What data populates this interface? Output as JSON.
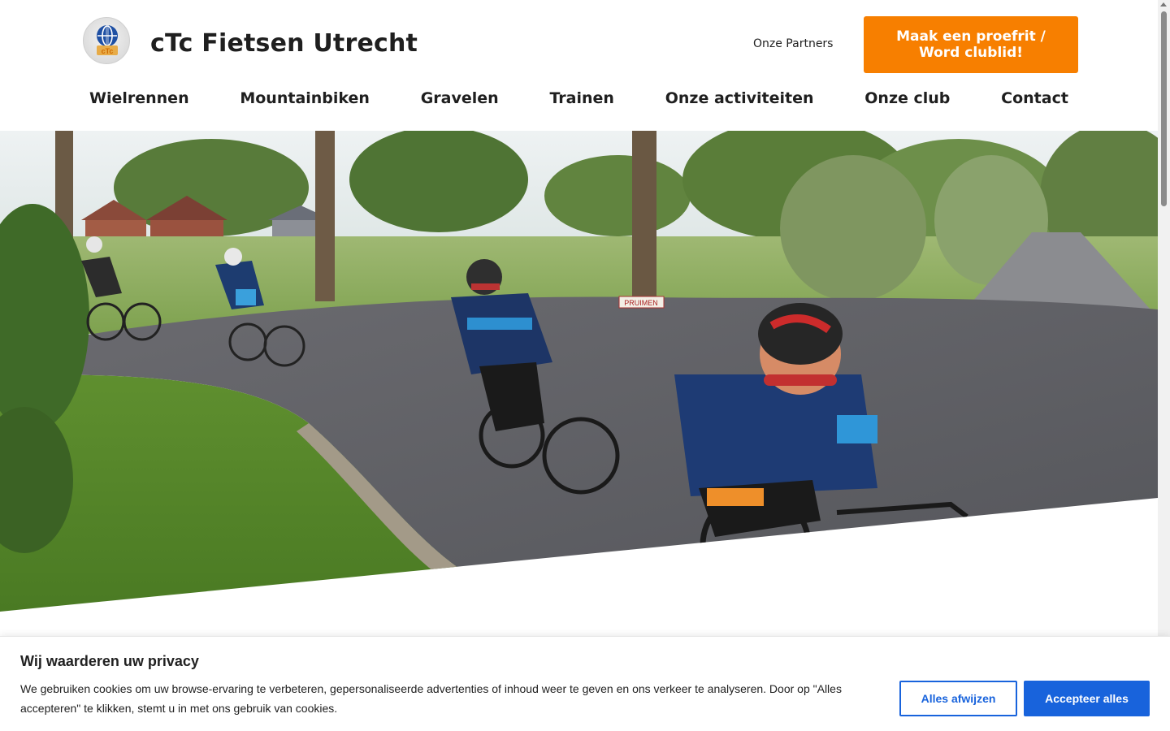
{
  "header": {
    "site_title": "cTc Fietsen Utrecht",
    "logo_text": "cTc",
    "partners_label": "Onze Partners",
    "cta_label": "Maak een proefrit / Word clublid!"
  },
  "nav": {
    "items": [
      {
        "label": "Wielrennen"
      },
      {
        "label": "Mountainbiken"
      },
      {
        "label": "Gravelen"
      },
      {
        "label": "Trainen"
      },
      {
        "label": "Onze activiteiten"
      },
      {
        "label": "Onze club"
      },
      {
        "label": "Contact"
      }
    ]
  },
  "hero": {
    "sign_text": "PRUIMEN"
  },
  "cookie_banner": {
    "title": "Wij waarderen uw privacy",
    "text": "We gebruiken cookies om uw browse-ervaring te verbeteren, gepersonaliseerde advertenties of inhoud weer te geven en ons verkeer te analyseren. Door op \"Alles accepteren\" te klikken, stemt u in met ons gebruik van cookies.",
    "reject_label": "Alles afwijzen",
    "accept_label": "Accepteer alles"
  },
  "colors": {
    "cta": "#f77f00",
    "cookie_primary": "#1863dc",
    "text_dark": "#1f1f1f"
  }
}
